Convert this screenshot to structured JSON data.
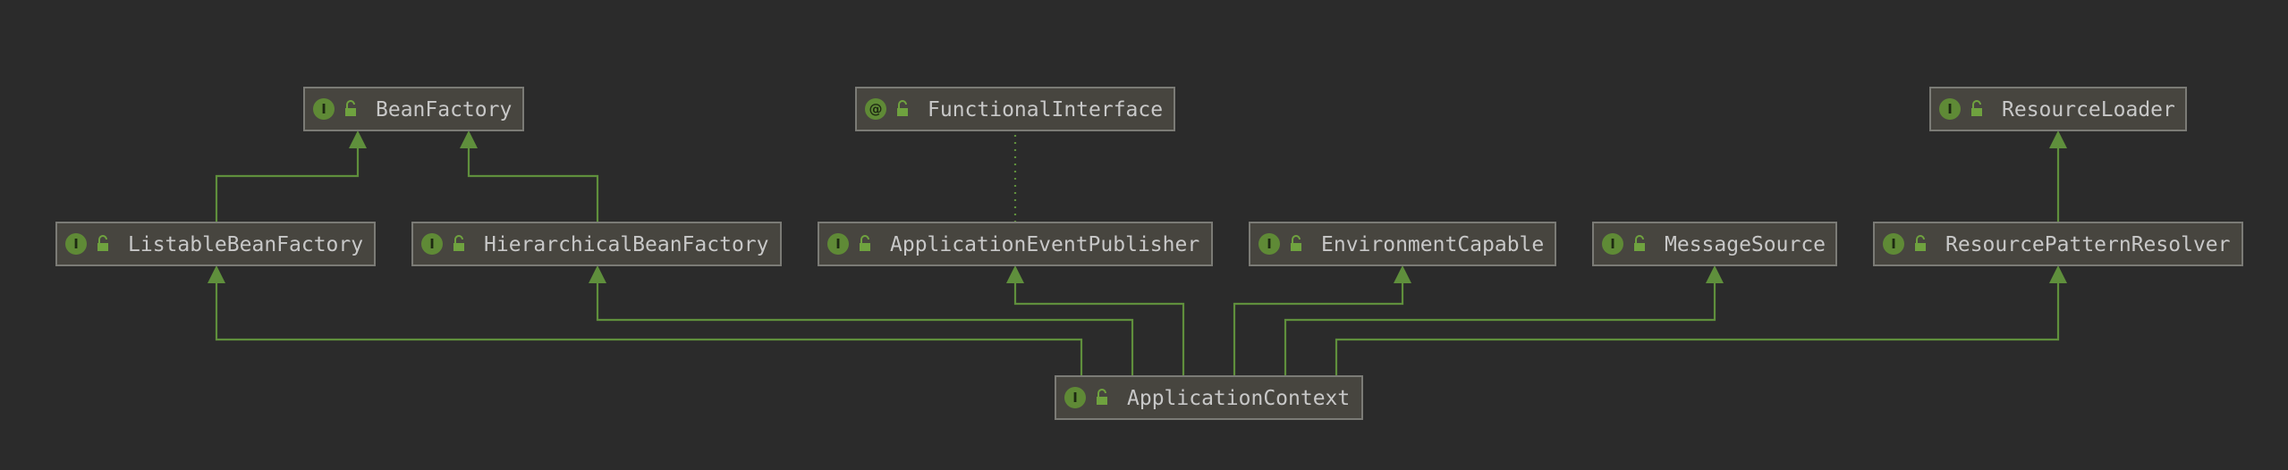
{
  "diagram": {
    "nodes": [
      {
        "id": "bean-factory",
        "label": "BeanFactory",
        "badge": "I"
      },
      {
        "id": "functional-interface",
        "label": "FunctionalInterface",
        "badge": "@"
      },
      {
        "id": "resource-loader",
        "label": "ResourceLoader",
        "badge": "I"
      },
      {
        "id": "listable-bean-factory",
        "label": "ListableBeanFactory",
        "badge": "I"
      },
      {
        "id": "hierarchical-bean-factory",
        "label": "HierarchicalBeanFactory",
        "badge": "I"
      },
      {
        "id": "application-event-publisher",
        "label": "ApplicationEventPublisher",
        "badge": "I"
      },
      {
        "id": "environment-capable",
        "label": "EnvironmentCapable",
        "badge": "I"
      },
      {
        "id": "message-source",
        "label": "MessageSource",
        "badge": "I"
      },
      {
        "id": "resource-pattern-resolver",
        "label": "ResourcePatternResolver",
        "badge": "I"
      },
      {
        "id": "application-context",
        "label": "ApplicationContext",
        "badge": "I"
      }
    ],
    "edges": [
      {
        "from": "listable-bean-factory",
        "to": "bean-factory",
        "style": "extends"
      },
      {
        "from": "hierarchical-bean-factory",
        "to": "bean-factory",
        "style": "extends"
      },
      {
        "from": "application-event-publisher",
        "to": "functional-interface",
        "style": "annotated"
      },
      {
        "from": "resource-pattern-resolver",
        "to": "resource-loader",
        "style": "extends"
      },
      {
        "from": "application-context",
        "to": "listable-bean-factory",
        "style": "extends"
      },
      {
        "from": "application-context",
        "to": "hierarchical-bean-factory",
        "style": "extends"
      },
      {
        "from": "application-context",
        "to": "application-event-publisher",
        "style": "extends"
      },
      {
        "from": "application-context",
        "to": "environment-capable",
        "style": "extends"
      },
      {
        "from": "application-context",
        "to": "message-source",
        "style": "extends"
      },
      {
        "from": "application-context",
        "to": "resource-pattern-resolver",
        "style": "extends"
      }
    ],
    "colors": {
      "background": "#2b2b2b",
      "node_fill": "#47453f",
      "node_border": "#7b7b76",
      "text": "#c8c8c8",
      "edge": "#5f8f3c",
      "badge": "#5f8a36"
    }
  }
}
